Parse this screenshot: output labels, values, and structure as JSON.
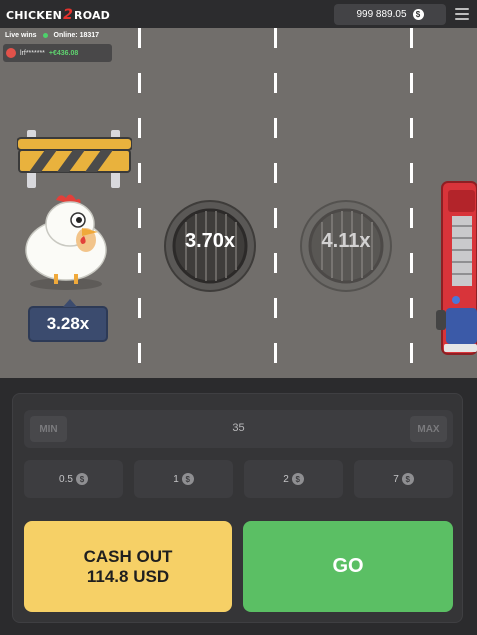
{
  "header": {
    "logo_left": "CHICKEN",
    "logo_num": "2",
    "logo_right": "ROAD",
    "balance": "999 889.05",
    "currency_symbol": "$"
  },
  "live": {
    "title": "Live wins",
    "online": "Online: 18317",
    "win_user": "lrf*******",
    "win_amount": "+€436.08"
  },
  "game": {
    "current_multiplier": "3.28x",
    "lane_multipliers": [
      "3.70x",
      "4.11x"
    ]
  },
  "controls": {
    "min_label": "MIN",
    "max_label": "MAX",
    "bet_value": "35",
    "quick_bets": [
      "0.5",
      "1",
      "2",
      "7"
    ],
    "coin_symbol": "$",
    "cashout_label": "CASH OUT",
    "cashout_amount": "114.8 USD",
    "go_label": "GO"
  },
  "colors": {
    "road": "#716e6b",
    "cashout": "#f6d066",
    "go": "#5bbf64",
    "multiplier_badge": "#3b4b6e"
  }
}
